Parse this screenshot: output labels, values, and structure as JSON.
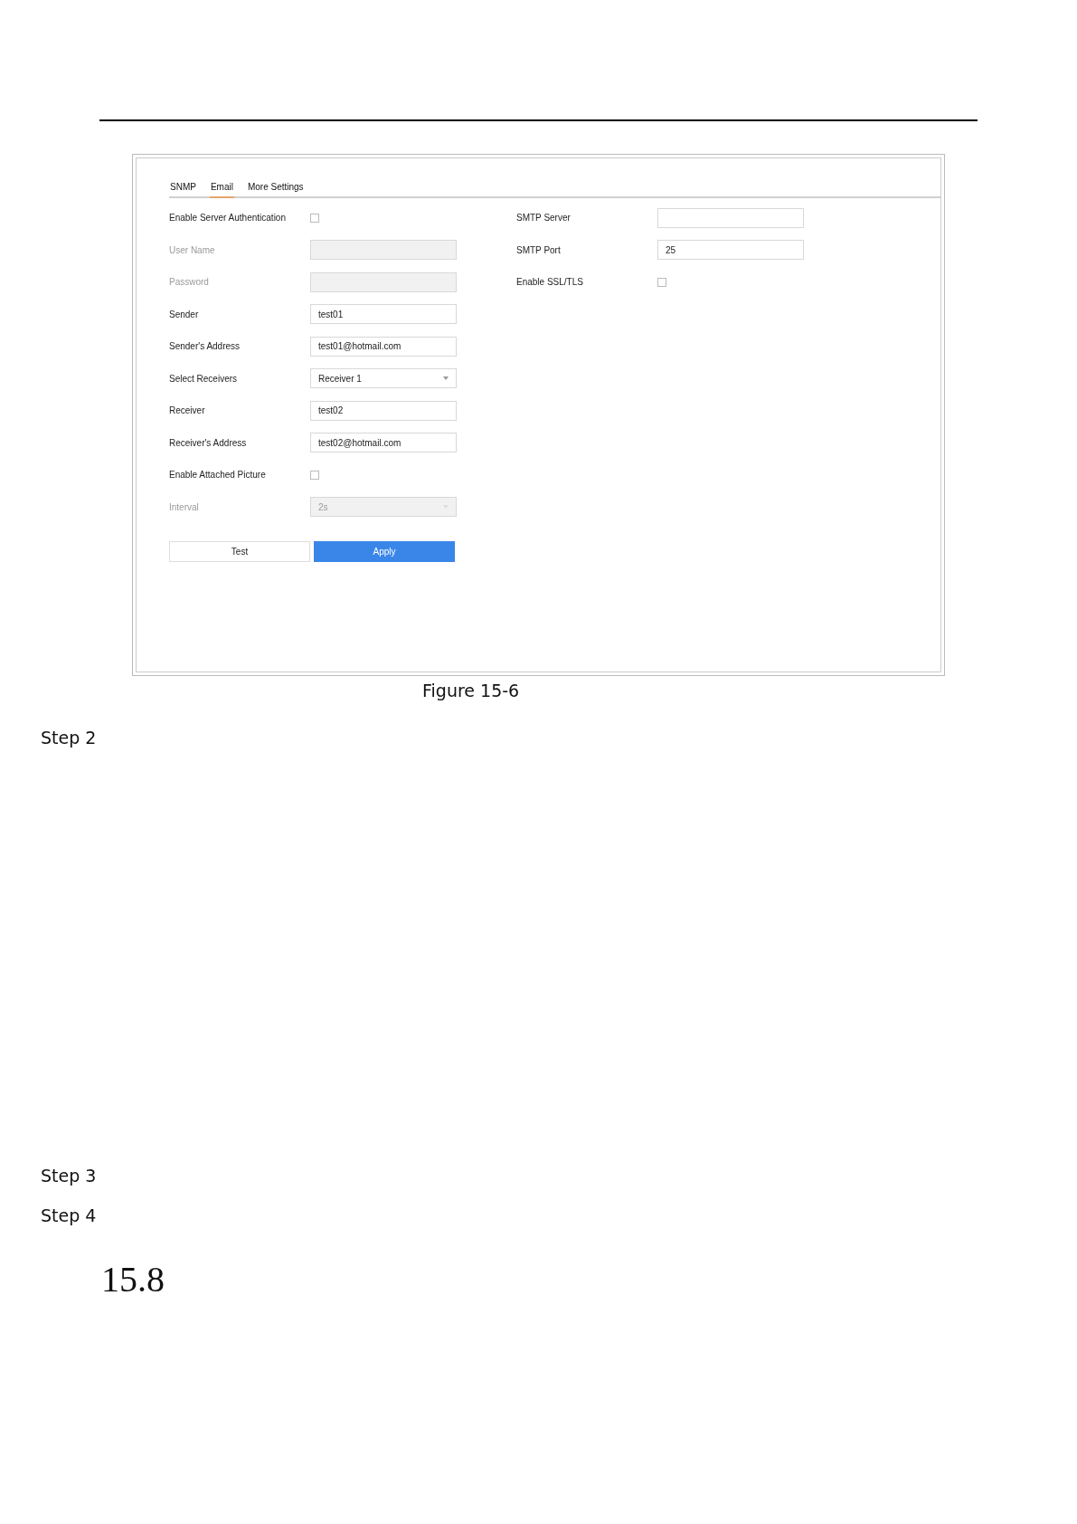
{
  "figure": {
    "tabs": [
      {
        "label": "SNMP",
        "selected": false
      },
      {
        "label": "Email",
        "selected": true
      },
      {
        "label": "More Settings",
        "selected": false
      }
    ],
    "left_fields": [
      {
        "kind": "checkbox",
        "label": "Enable Server Authentication",
        "checked": false,
        "disabled": false
      },
      {
        "kind": "text",
        "label": "User Name",
        "disabled": true
      },
      {
        "kind": "text",
        "label": "Password",
        "disabled": true
      },
      {
        "kind": "text",
        "label": "Sender",
        "value": "test01",
        "disabled": false
      },
      {
        "kind": "text",
        "label": "Sender's Address",
        "value": "test01@hotmail.com",
        "disabled": false
      },
      {
        "kind": "select",
        "label": "Select Receivers",
        "value": "Receiver 1",
        "disabled": false
      },
      {
        "kind": "text",
        "label": "Receiver",
        "value": "test02",
        "disabled": false
      },
      {
        "kind": "text",
        "label": "Receiver's Address",
        "value": "test02@hotmail.com",
        "disabled": false
      },
      {
        "kind": "checkbox",
        "label": "Enable Attached Picture",
        "checked": false,
        "disabled": false
      },
      {
        "kind": "select",
        "label": "Interval",
        "value": "2s",
        "disabled": true
      }
    ],
    "right_fields": [
      {
        "kind": "text",
        "label": "SMTP Server",
        "disabled": false
      },
      {
        "kind": "text",
        "label": "SMTP Port",
        "value": "25",
        "disabled": false
      },
      {
        "kind": "checkbox",
        "label": "Enable SSL/TLS",
        "checked": false,
        "disabled": false
      }
    ],
    "buttons": [
      {
        "label": "Test",
        "primary": false
      },
      {
        "label": "Apply",
        "primary": true
      }
    ]
  },
  "caption": "Figure 15-6",
  "steps": [
    "Step 2",
    "Step 3",
    "Step 4"
  ],
  "section_number": "15.8"
}
